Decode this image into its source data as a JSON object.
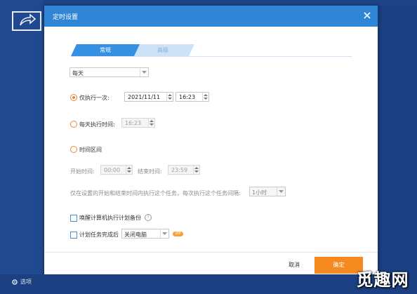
{
  "dialog": {
    "title": "定时设置",
    "tabs": [
      {
        "label": "常规",
        "active": true
      },
      {
        "label": "高级",
        "active": false
      }
    ],
    "frequency": {
      "value": "每天"
    },
    "once": {
      "label": "仅执行一次:",
      "selected": true,
      "date": "2021/11/11",
      "time": "16:23"
    },
    "daily": {
      "label": "每天执行时间:",
      "selected": false,
      "time": "16:23"
    },
    "interval": {
      "label": "时间区间",
      "selected": false,
      "start_label": "开始时间:",
      "start": "00:00",
      "end_label": "结束时间:",
      "end": "23:59",
      "desc": "仅在设置的开始和结束时间内执行这个任务，每次执行这个任务间隔:",
      "gap": "1小时"
    },
    "wake": {
      "label": "唤醒计算机执行计划备份",
      "checked": false
    },
    "after": {
      "label": "计划任务完成后",
      "checked": false,
      "action": "关闭电脑",
      "badge": "VIP"
    },
    "buttons": {
      "cancel": "取消",
      "ok": "确定"
    }
  },
  "taskbar": {
    "options": "选项",
    "item2": "",
    "item3": ""
  },
  "watermark": "觅趣网",
  "colors": {
    "titlebar": "#2f86d6",
    "accent": "#f58a21",
    "desktop": "#1a3f82",
    "tab_active": "#3690e2"
  },
  "icons": [
    "share-icon",
    "close-icon",
    "chevron-down-icon",
    "help-icon",
    "gear-icon"
  ]
}
